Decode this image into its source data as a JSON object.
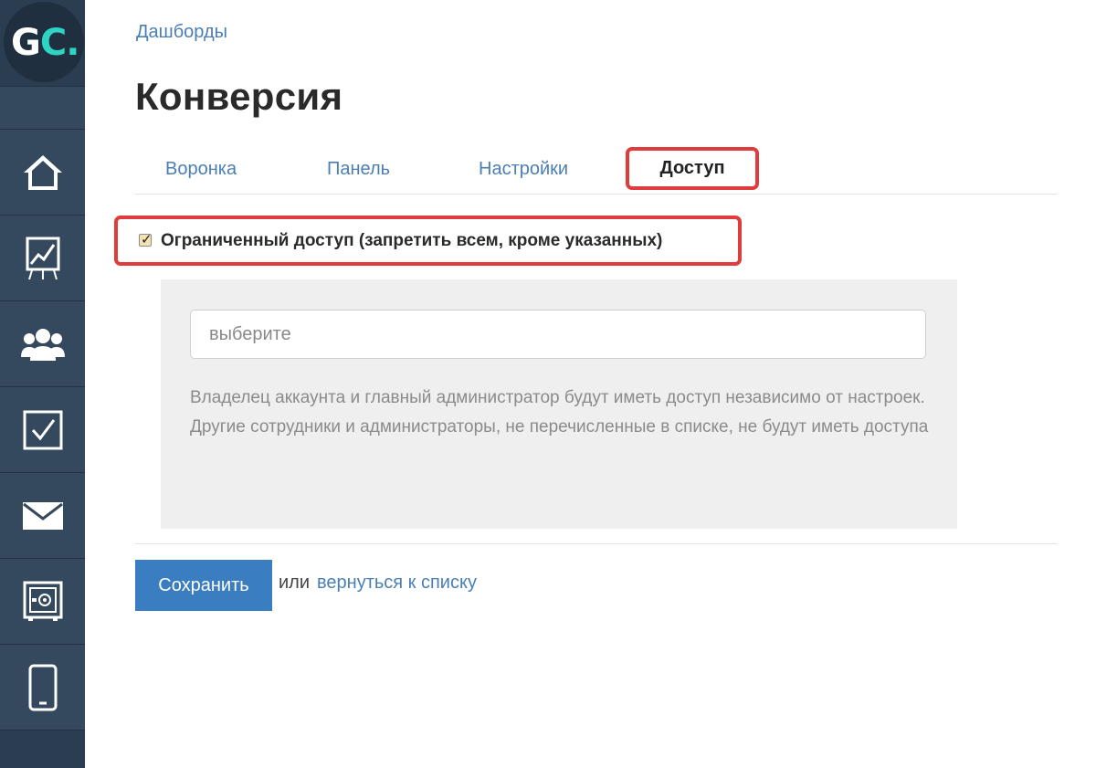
{
  "sidebar": {
    "logo": {
      "letters": "GC",
      "dot": ".",
      "accent_color": "#2fd3c3"
    },
    "items": [
      {
        "name": "home-icon"
      },
      {
        "name": "chart-board-icon"
      },
      {
        "name": "users-group-icon"
      },
      {
        "name": "checkbox-task-icon"
      },
      {
        "name": "envelope-icon"
      },
      {
        "name": "safe-icon"
      },
      {
        "name": "mobile-phone-icon"
      }
    ],
    "background_color": "#34495e"
  },
  "breadcrumb": "Дашборды",
  "page_title": "Конверсия",
  "tabs": [
    {
      "label": "Воронка"
    },
    {
      "label": "Панель"
    },
    {
      "label": "Настройки"
    },
    {
      "label": "Доступ",
      "active": true
    }
  ],
  "access": {
    "checked": true,
    "label": "Ограниченный доступ (запретить всем, кроме указанных)"
  },
  "select": {
    "placeholder": "выберите"
  },
  "note": {
    "line1": "Владелец аккаунта и главный администратор будут иметь доступ независимо от настроек.",
    "line2": "Другие сотрудники и администраторы, не перечисленные в списке, не будут иметь доступа"
  },
  "actions": {
    "save_label": "Сохранить",
    "or_text": "или",
    "back_link": "вернуться к списку",
    "primary_color": "#3a7dc0"
  },
  "highlight_color": "#e03c3c"
}
